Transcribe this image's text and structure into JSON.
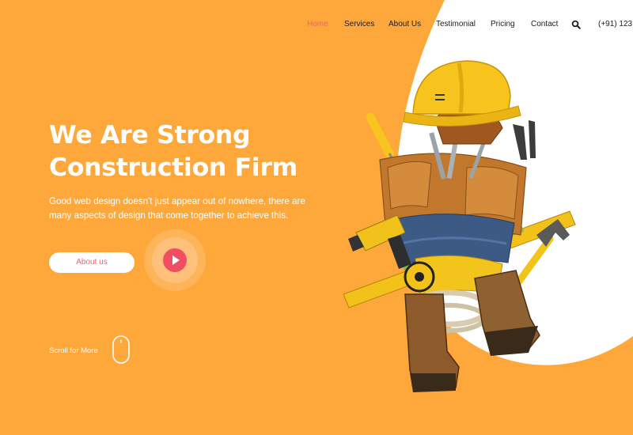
{
  "nav": {
    "items": [
      {
        "label": "Home",
        "active": true
      },
      {
        "label": "Services",
        "active": false
      },
      {
        "label": "About Us",
        "active": false
      },
      {
        "label": "Testimonial",
        "active": false
      },
      {
        "label": "Pricing",
        "active": false
      },
      {
        "label": "Contact",
        "active": false
      }
    ],
    "phone": "(+91) 123"
  },
  "hero": {
    "title_line1": "We Are Strong",
    "title_line2": "Construction Firm",
    "description": "Good web design doesn't just appear out of nowhere, there are many aspects of design that come together to achieve this.",
    "button_label": "About us",
    "scroll_label": "Scroll for More"
  },
  "icons": {
    "search": "search-icon",
    "play": "play-icon",
    "mouse": "mouse-scroll-icon"
  },
  "colors": {
    "background": "#fea83b",
    "accent": "#f45f6b",
    "play": "#f24e63",
    "text_light": "#ffffff",
    "text_dark": "#1c1c1c"
  }
}
